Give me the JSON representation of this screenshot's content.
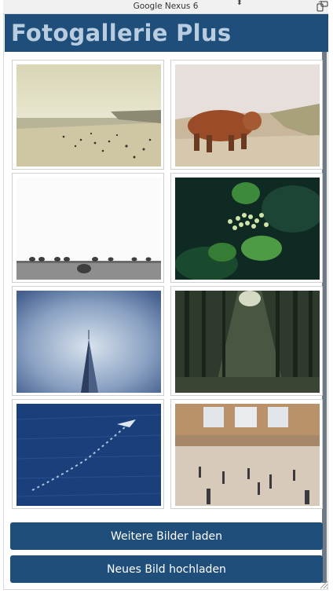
{
  "device_bar": {
    "device_name": "Google Nexus 6",
    "select_arrows": "⬍"
  },
  "app": {
    "title": "Fotogallerie Plus"
  },
  "gallery": {
    "photos": [
      {
        "subject": "beach"
      },
      {
        "subject": "highland-cow"
      },
      {
        "subject": "hay-bales"
      },
      {
        "subject": "green-plant"
      },
      {
        "subject": "skyscraper"
      },
      {
        "subject": "forest"
      },
      {
        "subject": "ocean"
      },
      {
        "subject": "station-hall"
      }
    ]
  },
  "actions": {
    "load_more": "Weitere Bilder laden",
    "upload": "Neues Bild hochladen"
  },
  "colors": {
    "header_bg": "#1f4e7a",
    "title_text": "#b9cde0",
    "button_bg": "#1f4e7a",
    "button_text": "#ffffff"
  }
}
